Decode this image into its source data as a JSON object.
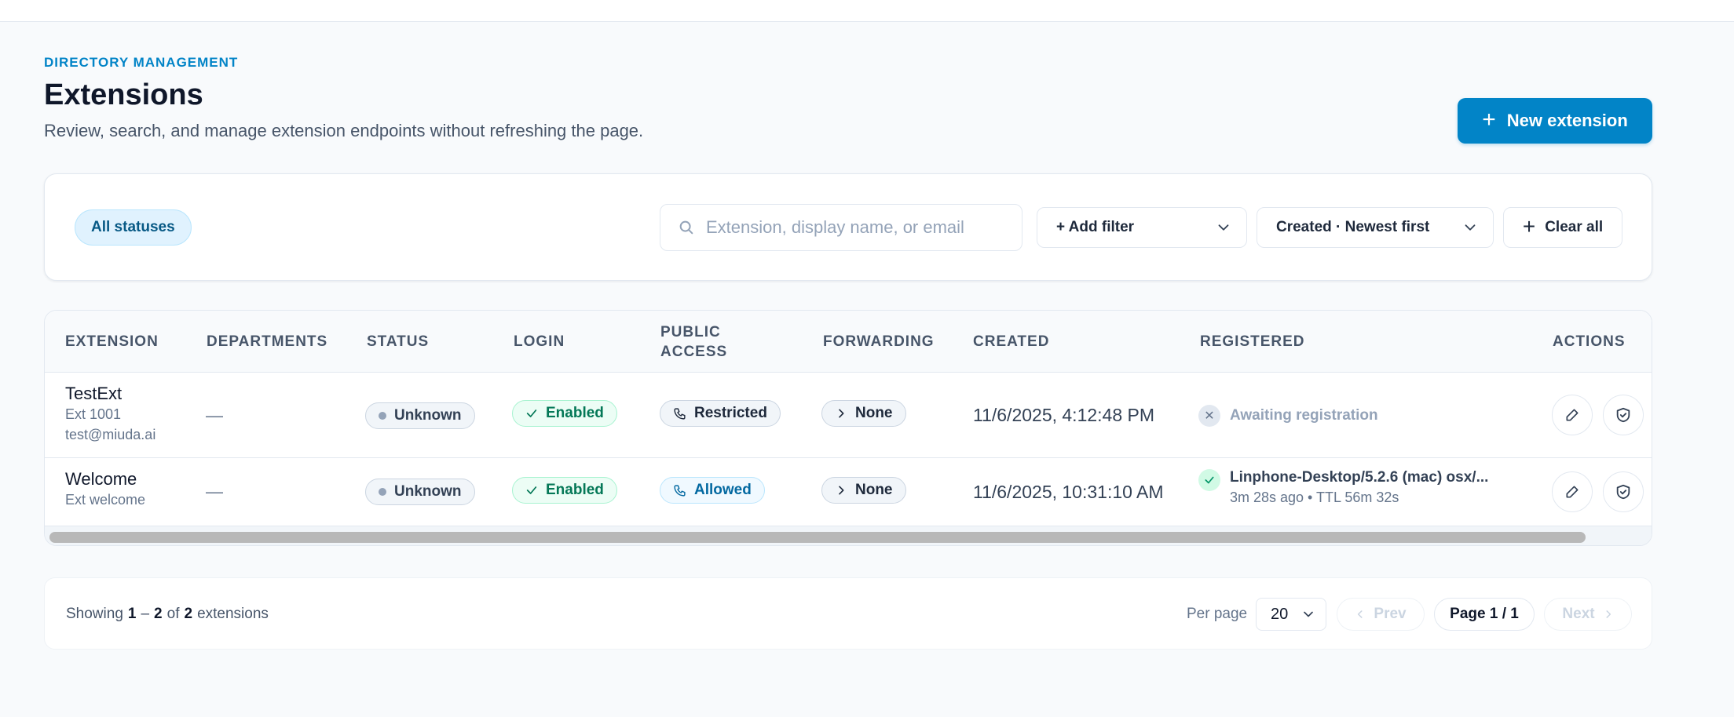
{
  "header": {
    "eyebrow": "DIRECTORY MANAGEMENT",
    "title": "Extensions",
    "subtitle": "Review, search, and manage extension endpoints without refreshing the page.",
    "new_button_label": "New extension"
  },
  "filters": {
    "status_chip": "All statuses",
    "search_placeholder": "Extension, display name, or email",
    "search_value": "",
    "add_filter_label": "+ Add filter",
    "sort_label": "Created · Newest first",
    "clear_label": "Clear all"
  },
  "table": {
    "columns": {
      "extension": "EXTENSION",
      "departments": "DEPARTMENTS",
      "status": "STATUS",
      "login": "LOGIN",
      "public_access_1": "PUBLIC",
      "public_access_2": "ACCESS",
      "forwarding": "FORWARDING",
      "created": "CREATED",
      "registered": "REGISTERED",
      "actions": "ACTIONS"
    },
    "rows": [
      {
        "name": "TestExt",
        "ext": "Ext 1001",
        "email": "test@miuda.ai",
        "departments": "—",
        "status": "Unknown",
        "login": "Enabled",
        "public_access": "Restricted",
        "forwarding": "None",
        "created": "11/6/2025, 4:12:48 PM",
        "registered_main": "Awaiting registration",
        "registered_sub": ""
      },
      {
        "name": "Welcome",
        "ext": "Ext welcome",
        "email": "",
        "departments": "—",
        "status": "Unknown",
        "login": "Enabled",
        "public_access": "Allowed",
        "forwarding": "None",
        "created": "11/6/2025, 10:31:10 AM",
        "registered_main": "Linphone-Desktop/5.2.6 (mac) osx/...",
        "registered_sub": "3m 28s ago • TTL 56m 32s"
      }
    ]
  },
  "pager": {
    "showing": "Showing",
    "from": "1",
    "dash": "–",
    "to": "2",
    "of": "of",
    "total": "2",
    "noun": "extensions",
    "per_page_label": "Per page",
    "per_page_value": "20",
    "prev_label": "Prev",
    "page_label": "Page 1 / 1",
    "next_label": "Next"
  },
  "colors": {
    "accent": "#0284c7",
    "success": "#047857",
    "muted": "#94a3b8"
  },
  "icons": [
    "plus-icon",
    "search-icon",
    "chevron-down-icon",
    "check-icon",
    "phone-icon",
    "chevron-right-icon",
    "x-icon",
    "edit-icon",
    "shield-check-icon",
    "chevron-left-icon"
  ]
}
